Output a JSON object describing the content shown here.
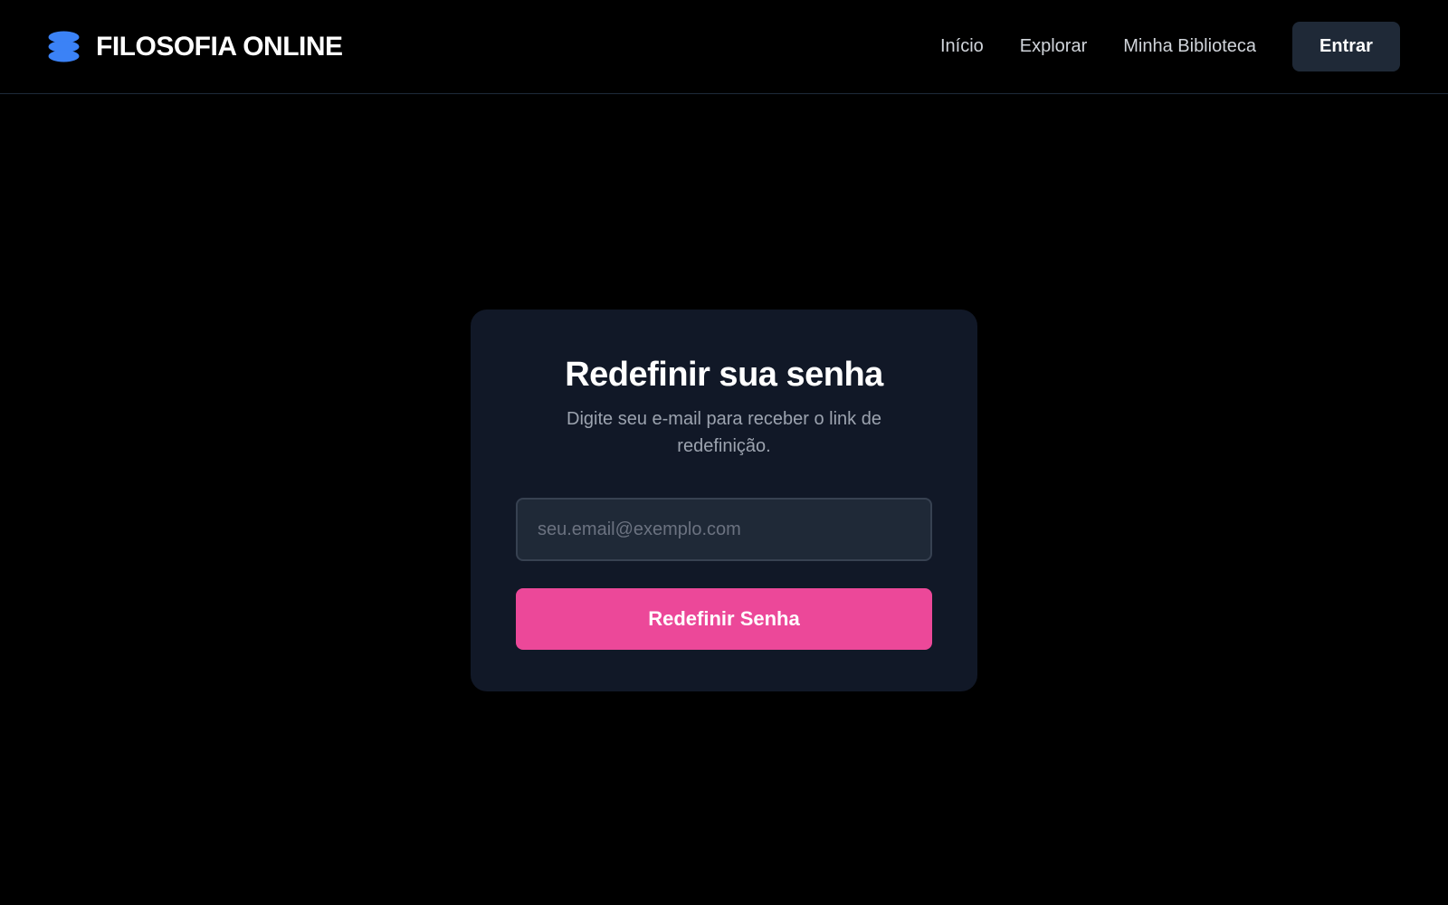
{
  "header": {
    "brand": "FILOSOFIA ONLINE",
    "brand_icon": "stacked-layers-icon",
    "nav": [
      {
        "label": "Início"
      },
      {
        "label": "Explorar"
      },
      {
        "label": "Minha Biblioteca"
      }
    ],
    "login_label": "Entrar"
  },
  "reset_form": {
    "title": "Redefinir sua senha",
    "subtitle": "Digite seu e-mail para receber o link de redefinição.",
    "email_placeholder": "seu.email@exemplo.com",
    "email_value": "",
    "submit_label": "Redefinir Senha"
  },
  "colors": {
    "background": "#000000",
    "card": "#111827",
    "brand_icon": "#3b82f6",
    "accent": "#ec4899",
    "secondary_button": "#1f2937"
  }
}
